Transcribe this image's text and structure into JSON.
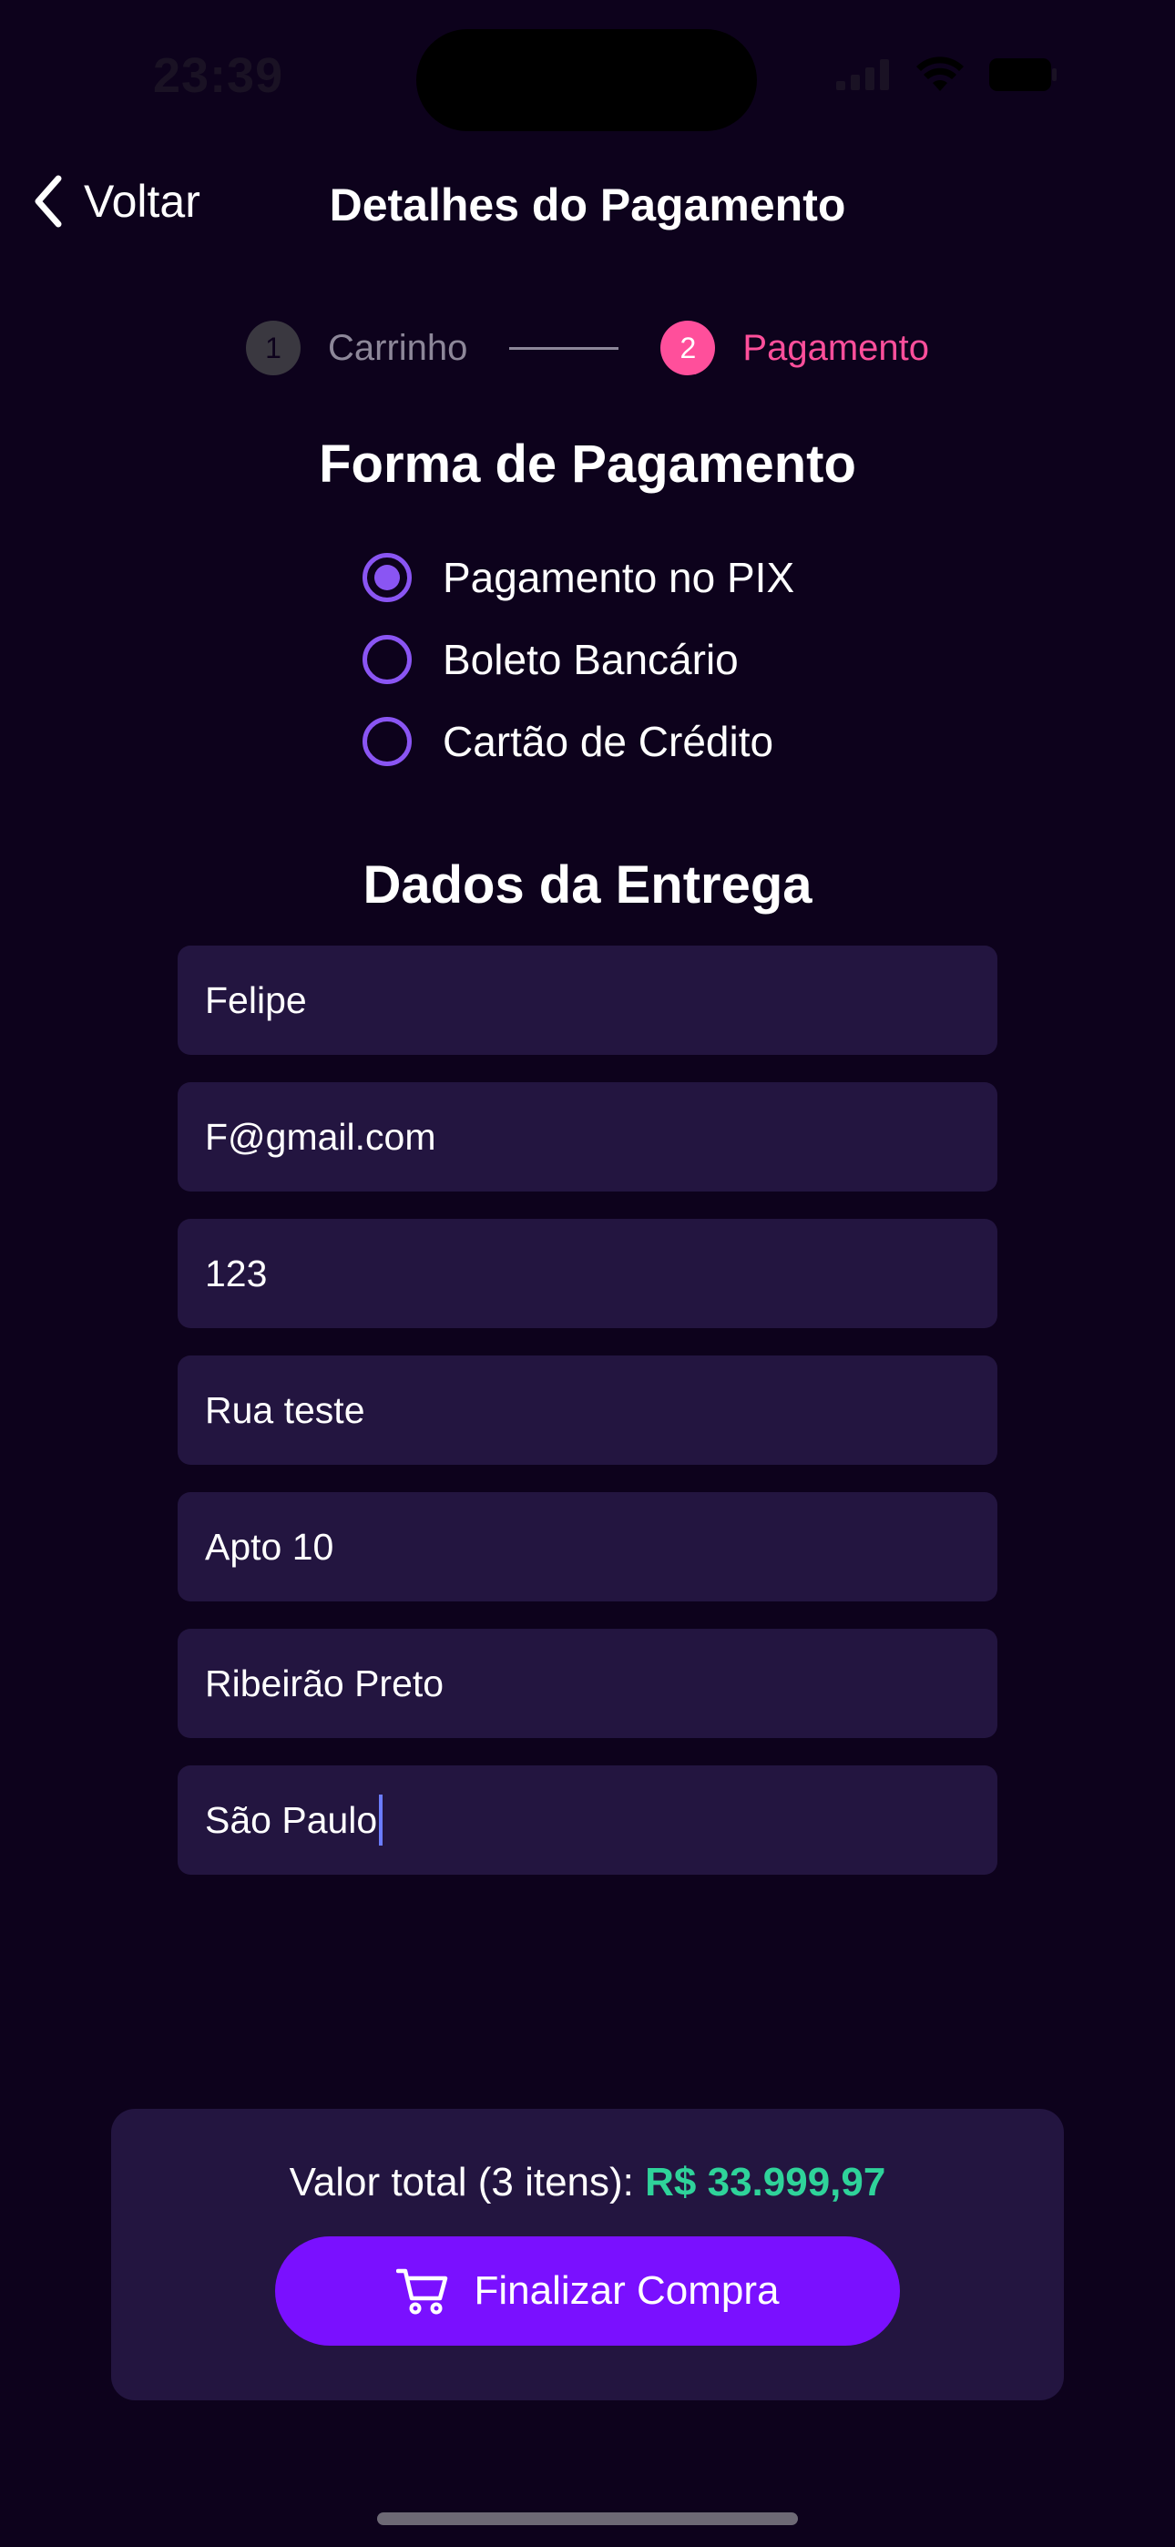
{
  "status_bar": {
    "time": "23:39"
  },
  "nav": {
    "back_label": "Voltar",
    "title": "Detalhes do Pagamento"
  },
  "stepper": {
    "steps": [
      {
        "number": "1",
        "label": "Carrinho",
        "state": "inactive"
      },
      {
        "number": "2",
        "label": "Pagamento",
        "state": "active"
      }
    ]
  },
  "payment": {
    "title": "Forma de Pagamento",
    "options": [
      {
        "label": "Pagamento no PIX",
        "selected": true
      },
      {
        "label": "Boleto Bancário",
        "selected": false
      },
      {
        "label": "Cartão de Crédito",
        "selected": false
      }
    ]
  },
  "delivery": {
    "title": "Dados da Entrega",
    "fields": [
      {
        "value": "Felipe"
      },
      {
        "value": "F@gmail.com"
      },
      {
        "value": "123"
      },
      {
        "value": "Rua teste"
      },
      {
        "value": "Apto 10"
      },
      {
        "value": "Ribeirão Preto"
      },
      {
        "value": "São Paulo"
      }
    ]
  },
  "footer": {
    "total_label": "Valor total (3 itens): ",
    "total_value": "R$ 33.999,97",
    "button_label": "Finalizar Compra"
  },
  "colors": {
    "background": "#0d021c",
    "accent_purple": "#8a55f3",
    "button": "#7a10ff",
    "step_active": "#ff4f9b",
    "price": "#2fd39a"
  }
}
